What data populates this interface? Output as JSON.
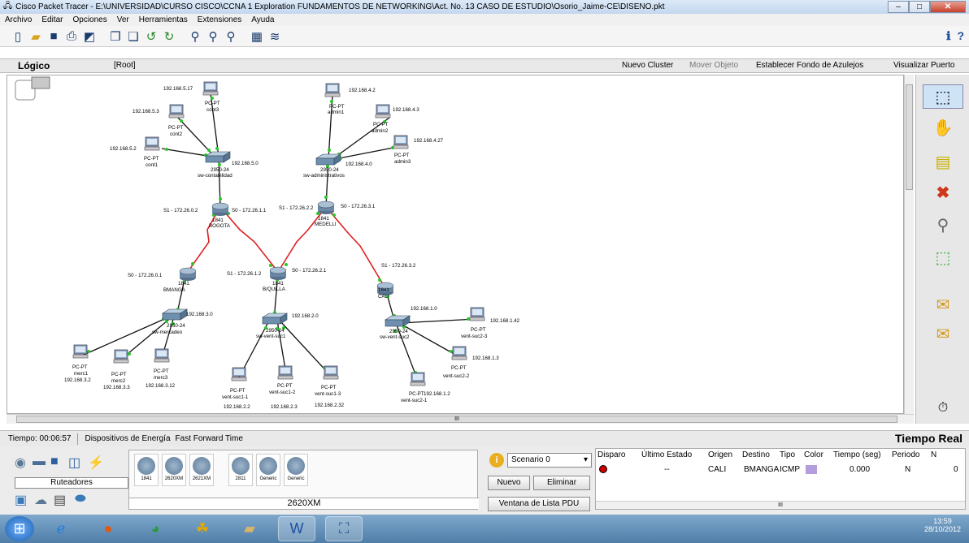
{
  "window": {
    "title": "Cisco Packet Tracer - E:\\UNIVERSIDAD\\CURSO CISCO\\CCNA 1 Exploration FUNDAMENTOS DE NETWORKING\\Act. No. 13 CASO DE ESTUDIO\\Osorio_Jaime-CE\\DISEÑO.pkt",
    "minimize": "–",
    "maximize": "□",
    "close": "✕"
  },
  "menu": [
    "Archivo",
    "Editar",
    "Opciones",
    "Ver",
    "Herramientas",
    "Extensiones",
    "Ayuda"
  ],
  "toolbar_icons": [
    "new-icon",
    "open-icon",
    "save-icon",
    "print-icon",
    "wizard-icon",
    "copy-icon",
    "paste-icon",
    "undo-icon",
    "redo-icon",
    "zoom-in-icon",
    "zoom-reset-icon",
    "zoom-out-icon",
    "palette-icon",
    "custom-device-icon"
  ],
  "workspace_bar": {
    "mode": "Lógico",
    "path": "[Root]",
    "new_cluster": "Nuevo Cluster",
    "move_object": "Mover Objeto",
    "set_tile": "Establecer Fondo de Azulejos",
    "viewport": "Visualizar Puerto"
  },
  "network": {
    "routers": [
      {
        "model": "1841",
        "name": "BOGOTA"
      },
      {
        "model": "1841",
        "name": "MEDELLI"
      },
      {
        "model": "1841",
        "name": "BMANGA"
      },
      {
        "model": "1841",
        "name": "B/QUILLA"
      },
      {
        "model": "1841",
        "name": "CALI"
      }
    ],
    "switches": [
      {
        "model": "2950-24",
        "name": "sw-contabilidad",
        "net": "192.168.5.0"
      },
      {
        "model": "2950-24",
        "name": "sw-administrativos",
        "net": "192.168.4.0"
      },
      {
        "model": "2950-24",
        "name": "sw-mercadeo",
        "net": "192.168.3.0"
      },
      {
        "model": "2950-24",
        "name": "sw-vent-suc1",
        "net": "192.168.2.0"
      },
      {
        "model": "2950-24",
        "name": "sw-vent-suc2",
        "net": "192.168.1.0"
      }
    ],
    "serial_labels": [
      "S1 - 172.26.0.2",
      "S0 - 172.26.1.1",
      "S1 - 172.26.2.2",
      "S0 - 172.26.3.1",
      "S0 - 172.26.0.1",
      "S1 - 172.26.1.2",
      "S0 - 172.26.2.1",
      "S1 - 172.26.3.2"
    ],
    "pcs": [
      {
        "type": "PC-PT",
        "name": "cont3",
        "ip": "192.168.5.17"
      },
      {
        "type": "PC-PT",
        "name": "cont2",
        "ip": "192.168.5.3"
      },
      {
        "type": "PC-PT",
        "name": "cont1",
        "ip": "192.168.5.2"
      },
      {
        "type": "PC-PT",
        "name": "admin1",
        "ip": "192.168.4.2"
      },
      {
        "type": "PC-PT",
        "name": "admin2",
        "ip": "192.168.4.3"
      },
      {
        "type": "PC-PT",
        "name": "admin3",
        "ip": "192.168.4.27"
      },
      {
        "type": "PC-PT",
        "name": "merc1",
        "ip": "192.168.3.2"
      },
      {
        "type": "PC-PT",
        "name": "merc2",
        "ip": "192.168.3.3"
      },
      {
        "type": "PC-PT",
        "name": "merc3",
        "ip": "192.168.3.12"
      },
      {
        "type": "PC-PT",
        "name": "vent-suc1-1",
        "ip": "192.168.2.2"
      },
      {
        "type": "PC-PT",
        "name": "vent-suc1-2",
        "ip": "192.168.2.3"
      },
      {
        "type": "PC-PT",
        "name": "vent-suc1-3",
        "ip": "192.168.2.32"
      },
      {
        "type": "PC-PT",
        "name": "vent-suc2-3",
        "ip": "192.168.1.42"
      },
      {
        "type": "PC-PT",
        "name": "vent-suc2-2",
        "ip": "192.168.1.3"
      },
      {
        "type": "PC-PT",
        "name": "vent-suc2-1",
        "ip": "192.168.1.2"
      }
    ]
  },
  "scrollbar_mark": "III",
  "status": {
    "time": "Tiempo: 00:06:57",
    "power": "Dispositivos de Energía",
    "fast_forward": "Fast Forward Time",
    "mode": "Tiempo Real"
  },
  "devices": {
    "category": "Ruteadores",
    "models": [
      "1841",
      "2620XM",
      "2621XM",
      "2811",
      "Generic",
      "Generic"
    ],
    "selected": "2620XM"
  },
  "scenario": {
    "select": "Scenario 0",
    "new": "Nuevo",
    "delete": "Eliminar",
    "pdu_list": "Ventana de Lista PDU"
  },
  "pdu": {
    "headers": [
      "Disparo",
      "Último Estado",
      "Origen",
      "Destino",
      "Tipo",
      "Color",
      "Tiempo (seg)",
      "Periodo",
      "N"
    ],
    "row": {
      "state": "--",
      "source": "CALI",
      "dest": "BMANGA",
      "type": "ICMP",
      "color": "#b39ddb",
      "time": "0.000",
      "period": "N",
      "num": "0"
    }
  },
  "tray": {
    "time": "13:59",
    "date": "28/10/2012"
  },
  "colors": {
    "serial_link": "#e02020",
    "link_up": "#28c828",
    "router": "#7f9cb8"
  }
}
